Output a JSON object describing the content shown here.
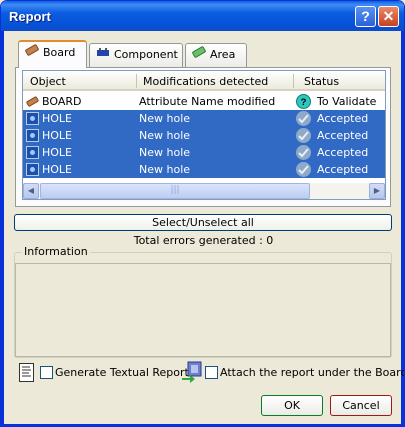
{
  "window": {
    "title": "Report"
  },
  "titlebar": {
    "help_label": "?",
    "close_label": "✕"
  },
  "tabs": [
    {
      "label": "Board",
      "icon": "board-icon"
    },
    {
      "label": "Component",
      "icon": "component-icon"
    },
    {
      "label": "Area",
      "icon": "area-icon"
    }
  ],
  "table": {
    "headers": [
      "Object",
      "Modifications detected",
      "Status"
    ],
    "rows": [
      {
        "object": "BOARD",
        "modification": "Attribute Name modified",
        "status": "To Validate",
        "icon": "board-icon",
        "status_icon": "question-icon",
        "selected": false
      },
      {
        "object": "HOLE",
        "modification": "New hole",
        "status": "Accepted",
        "icon": "hole-icon",
        "status_icon": "check-icon",
        "selected": true
      },
      {
        "object": "HOLE",
        "modification": "New hole",
        "status": "Accepted",
        "icon": "hole-icon",
        "status_icon": "check-icon",
        "selected": true
      },
      {
        "object": "HOLE",
        "modification": "New hole",
        "status": "Accepted",
        "icon": "hole-icon",
        "status_icon": "check-icon",
        "selected": true
      },
      {
        "object": "HOLE",
        "modification": "New hole",
        "status": "Accepted",
        "icon": "hole-icon",
        "status_icon": "check-icon",
        "selected": true
      }
    ]
  },
  "select_unselect_label": "Select/Unselect all",
  "total_errors": "Total errors generated  : 0",
  "information": {
    "label": "Information"
  },
  "options": {
    "generate_report_label": "Generate Textual Report",
    "attach_report_label": "Attach the report under the Board A"
  },
  "buttons": {
    "ok": "OK",
    "cancel": "Cancel"
  },
  "colors": {
    "title_blue": "#0653d8",
    "selection": "#316ac5",
    "ok_border": "#0b7a2a",
    "cancel_border": "#a01818"
  }
}
